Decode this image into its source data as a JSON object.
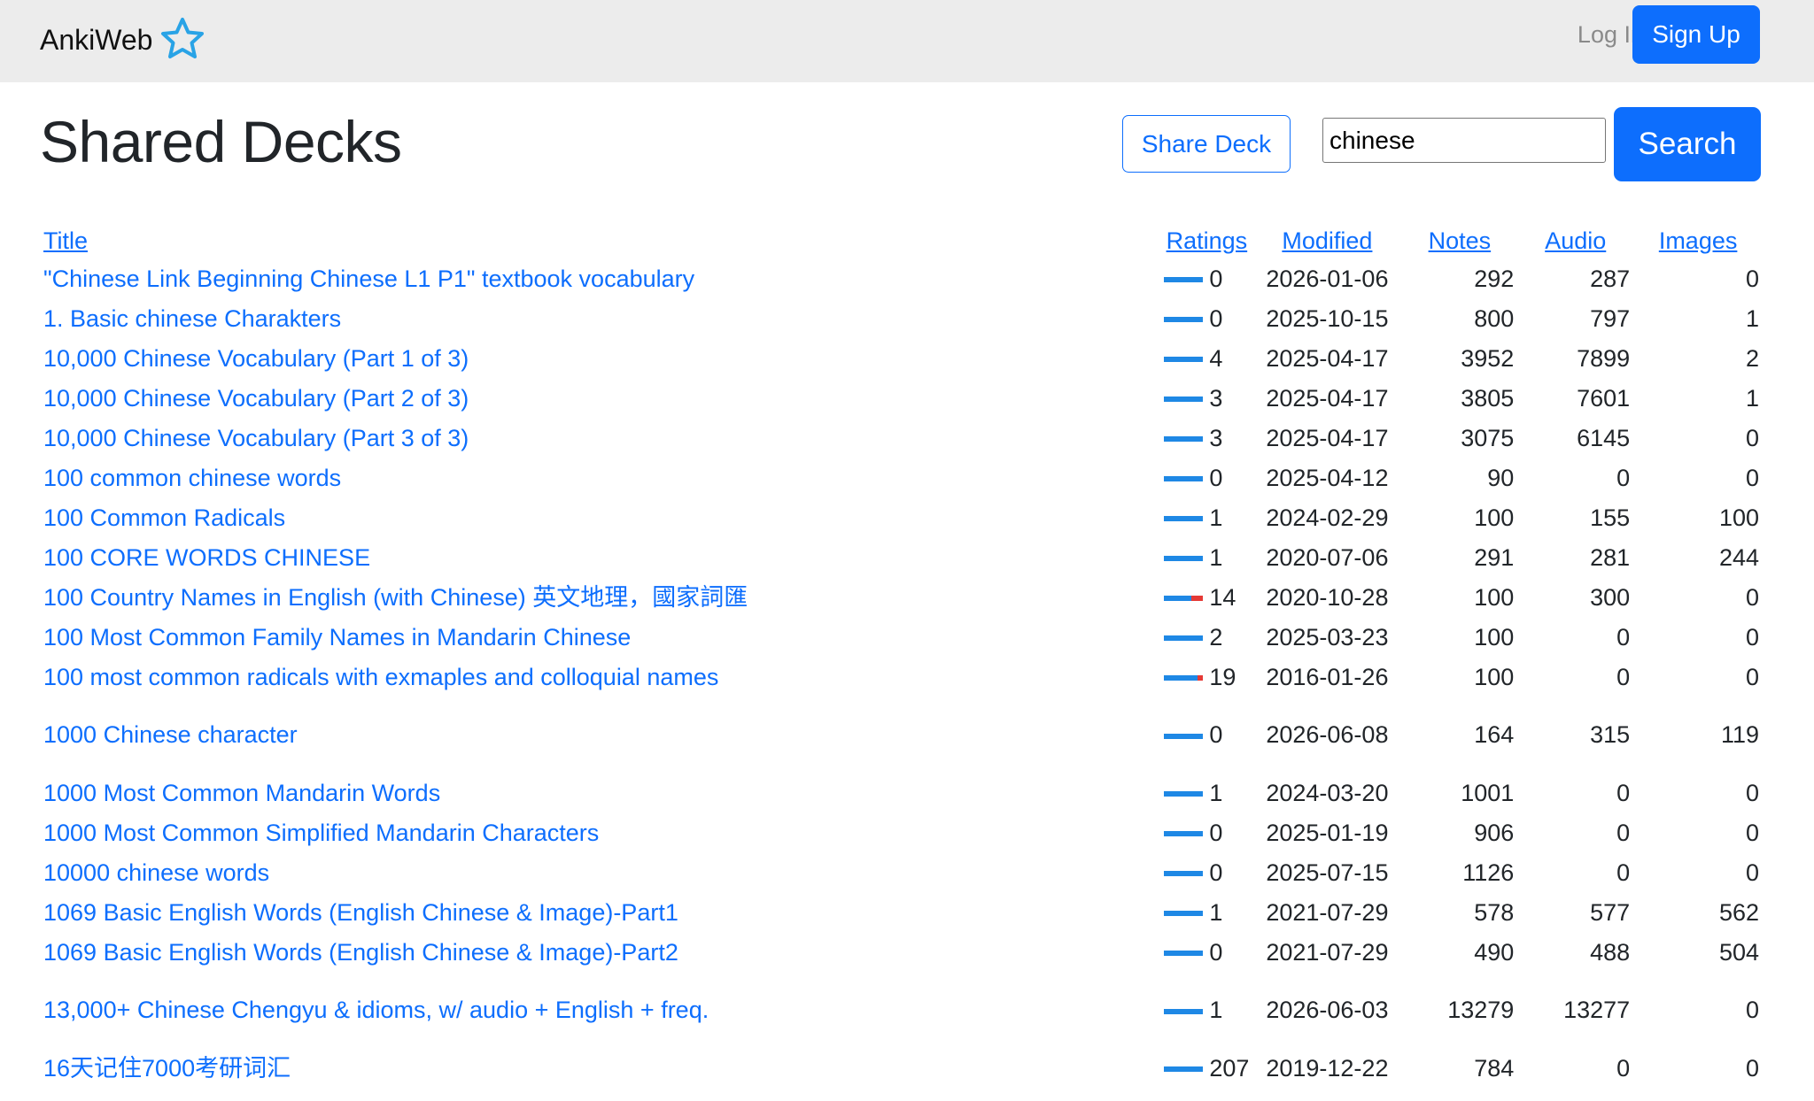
{
  "nav": {
    "brand": "AnkiWeb",
    "login": "Log In",
    "signup": "Sign Up"
  },
  "page": {
    "title": "Shared Decks",
    "share_label": "Share Deck",
    "search_value": "chinese",
    "search_label": "Search"
  },
  "colors": {
    "accent": "#0d6efd",
    "rating_positive": "#1e88e5",
    "rating_negative": "#e53935",
    "navbar_bg": "#ececec",
    "logo_star": "#29a3e6"
  },
  "table": {
    "headers": {
      "title": "Title",
      "ratings": "Ratings",
      "modified": "Modified",
      "notes": "Notes",
      "audio": "Audio",
      "images": "Images"
    },
    "rows": [
      {
        "title": "\"Chinese Link Beginning Chinese L1 P1\" textbook vocabulary",
        "ratings": "0",
        "negative_fraction": 0,
        "modified": "2026-01-06",
        "notes": "292",
        "audio": "287",
        "images": "0"
      },
      {
        "title": "1. Basic chinese Charakters",
        "ratings": "0",
        "negative_fraction": 0,
        "modified": "2025-10-15",
        "notes": "800",
        "audio": "797",
        "images": "1"
      },
      {
        "title": "10,000 Chinese Vocabulary (Part 1 of 3)",
        "ratings": "4",
        "negative_fraction": 0,
        "modified": "2025-04-17",
        "notes": "3952",
        "audio": "7899",
        "images": "2"
      },
      {
        "title": "10,000 Chinese Vocabulary (Part 2 of 3)",
        "ratings": "3",
        "negative_fraction": 0,
        "modified": "2025-04-17",
        "notes": "3805",
        "audio": "7601",
        "images": "1"
      },
      {
        "title": "10,000 Chinese Vocabulary (Part 3 of 3)",
        "ratings": "3",
        "negative_fraction": 0,
        "modified": "2025-04-17",
        "notes": "3075",
        "audio": "6145",
        "images": "0"
      },
      {
        "title": "100 common chinese words",
        "ratings": "0",
        "negative_fraction": 0,
        "modified": "2025-04-12",
        "notes": "90",
        "audio": "0",
        "images": "0"
      },
      {
        "title": "100 Common Radicals",
        "ratings": "1",
        "negative_fraction": 0,
        "modified": "2024-02-29",
        "notes": "100",
        "audio": "155",
        "images": "100"
      },
      {
        "title": "100 CORE WORDS CHINESE",
        "ratings": "1",
        "negative_fraction": 0,
        "modified": "2020-07-06",
        "notes": "291",
        "audio": "281",
        "images": "244"
      },
      {
        "title": "100 Country Names in English (with Chinese) 英文地理，國家詞匯",
        "ratings": "14",
        "negative_fraction": 0.3,
        "modified": "2020-10-28",
        "notes": "100",
        "audio": "300",
        "images": "0"
      },
      {
        "title": "100 Most Common Family Names in Mandarin Chinese",
        "ratings": "2",
        "negative_fraction": 0,
        "modified": "2025-03-23",
        "notes": "100",
        "audio": "0",
        "images": "0"
      },
      {
        "title": "100 most common radicals with exmaples and colloquial names",
        "ratings": "19",
        "negative_fraction": 0.15,
        "modified": "2016-01-26",
        "notes": "100",
        "audio": "0",
        "images": "0"
      },
      {
        "title": "1000 Chinese character",
        "ratings": "0",
        "negative_fraction": 0,
        "modified": "2026-06-08",
        "notes": "164",
        "audio": "315",
        "images": "119",
        "tall": true
      },
      {
        "title": "1000 Most Common Mandarin Words",
        "ratings": "1",
        "negative_fraction": 0,
        "modified": "2024-03-20",
        "notes": "1001",
        "audio": "0",
        "images": "0"
      },
      {
        "title": "1000 Most Common Simplified Mandarin Characters",
        "ratings": "0",
        "negative_fraction": 0,
        "modified": "2025-01-19",
        "notes": "906",
        "audio": "0",
        "images": "0"
      },
      {
        "title": "10000 chinese words",
        "ratings": "0",
        "negative_fraction": 0,
        "modified": "2025-07-15",
        "notes": "1126",
        "audio": "0",
        "images": "0"
      },
      {
        "title": "1069 Basic English Words (English Chinese & Image)-Part1",
        "ratings": "1",
        "negative_fraction": 0,
        "modified": "2021-07-29",
        "notes": "578",
        "audio": "577",
        "images": "562"
      },
      {
        "title": "1069 Basic English Words (English Chinese & Image)-Part2",
        "ratings": "0",
        "negative_fraction": 0,
        "modified": "2021-07-29",
        "notes": "490",
        "audio": "488",
        "images": "504"
      },
      {
        "title": "13,000+ Chinese Chengyu & idioms, w/ audio + English + freq.",
        "ratings": "1",
        "negative_fraction": 0,
        "modified": "2026-06-03",
        "notes": "13279",
        "audio": "13277",
        "images": "0",
        "tall": true
      },
      {
        "title": "16天记住7000考研词汇",
        "ratings": "207",
        "negative_fraction": 0,
        "modified": "2019-12-22",
        "notes": "784",
        "audio": "0",
        "images": "0"
      }
    ]
  }
}
